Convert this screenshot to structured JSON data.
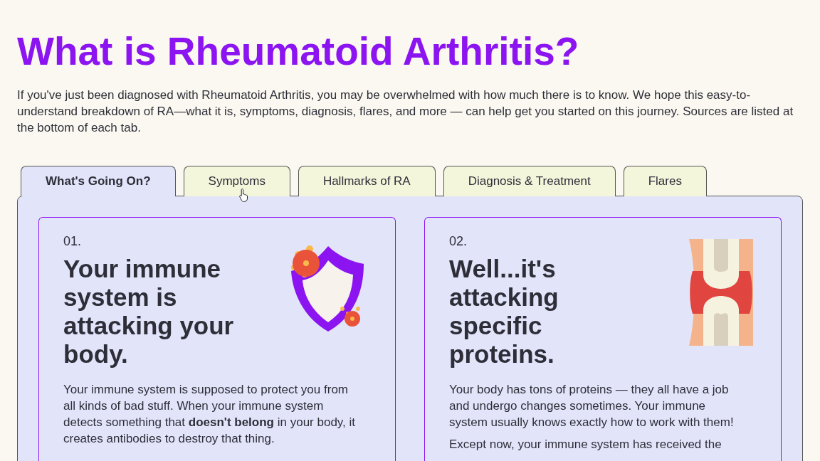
{
  "title": "What is Rheumatoid Arthritis?",
  "intro": "If you've just been diagnosed with Rheumatoid Arthritis, you may be overwhelmed with how much there is to know. We hope this easy-to-understand breakdown of RA—what it is, symptoms, diagnosis, flares, and more — can help get you started on this journey. Sources are listed at the bottom of each tab.",
  "tabs": [
    {
      "label": "What's Going On?",
      "selected": true
    },
    {
      "label": "Symptoms",
      "selected": false
    },
    {
      "label": "Hallmarks of RA",
      "selected": false
    },
    {
      "label": "Diagnosis & Treatment",
      "selected": false
    },
    {
      "label": "Flares",
      "selected": false
    }
  ],
  "cards": [
    {
      "number": "01.",
      "heading": "Your immune system is attacking your body.",
      "kind": "shield",
      "paragraphs": [
        "Your immune system is supposed to protect you from all kinds of bad stuff. When your immune system detects something that **doesn't belong** in your body, it creates antibodies to destroy that thing."
      ]
    },
    {
      "number": "02.",
      "heading": "Well...it's attacking specific proteins.",
      "kind": "joint",
      "paragraphs": [
        "Your body has tons of proteins — they all have a job and undergo changes sometimes. Your immune system usually knows exactly how to work with them!",
        "Except now, your immune system has received the"
      ]
    }
  ]
}
